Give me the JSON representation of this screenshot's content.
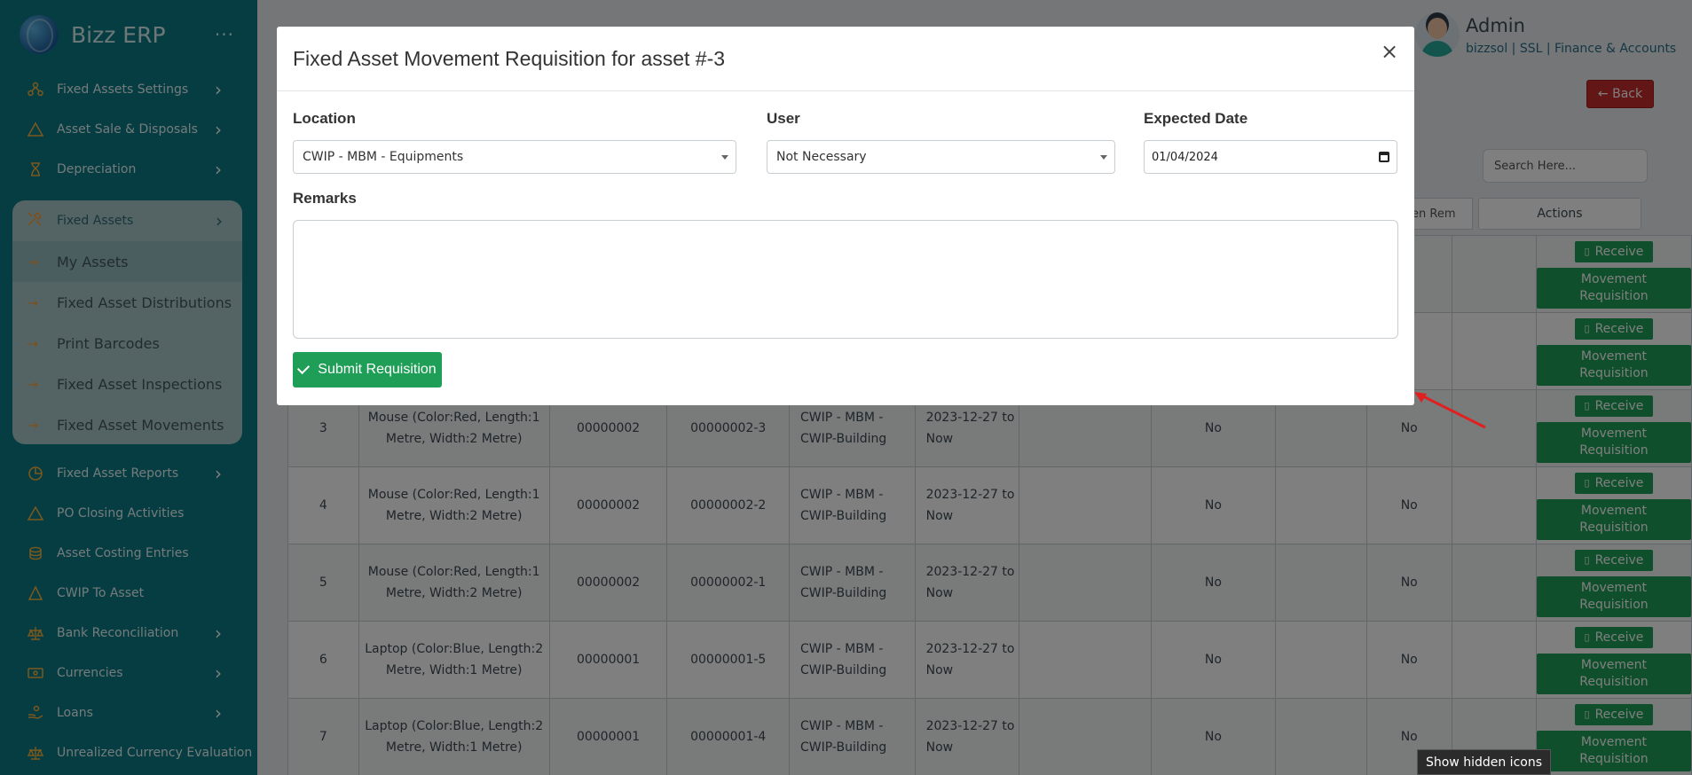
{
  "brand": {
    "name": "Bizz ERP",
    "menu_dots": "···"
  },
  "sidebar": {
    "top_items": [
      {
        "label": "Fixed Assets Settings"
      },
      {
        "label": "Asset Sale & Disposals"
      },
      {
        "label": "Depreciation"
      }
    ],
    "group": {
      "label": "Fixed Assets",
      "children": [
        {
          "label": "My Assets"
        },
        {
          "label": "Fixed Asset Distributions"
        },
        {
          "label": "Print Barcodes"
        },
        {
          "label": "Fixed Asset Inspections"
        },
        {
          "label": "Fixed Asset Movements"
        }
      ]
    },
    "bottom_items": [
      {
        "label": "Fixed Asset Reports"
      },
      {
        "label": "PO Closing Activities"
      },
      {
        "label": "Asset Costing Entries"
      },
      {
        "label": "CWIP To Asset"
      },
      {
        "label": "Bank Reconciliation"
      },
      {
        "label": "Currencies"
      },
      {
        "label": "Loans"
      },
      {
        "label": "Unrealized Currency Evaluation"
      }
    ]
  },
  "header": {
    "user_name": "Admin",
    "user_sub": "bizzsol | SSL  | Finance & Accounts",
    "back_label": "← Back",
    "search_placeholder": "Search Here...",
    "partial_col": "en Rem",
    "actions_col": "Actions"
  },
  "table": {
    "rows": [
      {
        "no": "",
        "item": "",
        "code": "",
        "tag": "",
        "location": "",
        "period": "",
        "a": "",
        "b": ""
      },
      {
        "no": "",
        "item": "",
        "code": "",
        "tag": "",
        "location": "",
        "period": "",
        "a": "",
        "b": ""
      },
      {
        "no": "3",
        "item_l1": "Mouse (Color:Red, Length:1",
        "item_l2": "Metre, Width:2 Metre)",
        "code": "00000002",
        "tag": "00000002-3",
        "loc_l1": "CWIP - MBM -",
        "loc_l2": "CWIP-Building",
        "per_l1": "2023-12-27 to",
        "per_l2": "Now",
        "a": "No",
        "b": "No"
      },
      {
        "no": "4",
        "item_l1": "Mouse (Color:Red, Length:1",
        "item_l2": "Metre, Width:2 Metre)",
        "code": "00000002",
        "tag": "00000002-2",
        "loc_l1": "CWIP - MBM -",
        "loc_l2": "CWIP-Building",
        "per_l1": "2023-12-27 to",
        "per_l2": "Now",
        "a": "No",
        "b": "No"
      },
      {
        "no": "5",
        "item_l1": "Mouse (Color:Red, Length:1",
        "item_l2": "Metre, Width:2 Metre)",
        "code": "00000002",
        "tag": "00000002-1",
        "loc_l1": "CWIP - MBM -",
        "loc_l2": "CWIP-Building",
        "per_l1": "2023-12-27 to",
        "per_l2": "Now",
        "a": "No",
        "b": "No"
      },
      {
        "no": "6",
        "item_l1": "Laptop (Color:Blue, Length:2",
        "item_l2": "Metre, Width:1 Metre)",
        "code": "00000001",
        "tag": "00000001-5",
        "loc_l1": "CWIP - MBM -",
        "loc_l2": "CWIP-Building",
        "per_l1": "2023-12-27 to",
        "per_l2": "Now",
        "a": "No",
        "b": "No"
      },
      {
        "no": "7",
        "item_l1": "Laptop (Color:Blue, Length:2",
        "item_l2": "Metre, Width:1 Metre)",
        "code": "00000001",
        "tag": "00000001-4",
        "loc_l1": "CWIP - MBM -",
        "loc_l2": "CWIP-Building",
        "per_l1": "2023-12-27 to",
        "per_l2": "Now",
        "a": "No",
        "b": "No"
      }
    ],
    "receive_label": "Receive",
    "movement_l1": "Movement",
    "movement_l2": "Requisition"
  },
  "modal": {
    "title": "Fixed Asset Movement Requisition for asset #-3",
    "close": "×",
    "location_label": "Location",
    "location_value": "CWIP - MBM - Equipments",
    "user_label": "User",
    "user_value": "Not Necessary",
    "date_label": "Expected Date",
    "date_value": "01/04/2024",
    "remarks_label": "Remarks",
    "remarks_value": "",
    "submit_label": "Submit Requisition"
  },
  "tooltip": "Show hidden icons",
  "colors": {
    "sidebar": "#0d7a85",
    "accent_green": "#1e9e56",
    "back_red": "#c52d2d",
    "icon_orange": "#f4b23d"
  }
}
